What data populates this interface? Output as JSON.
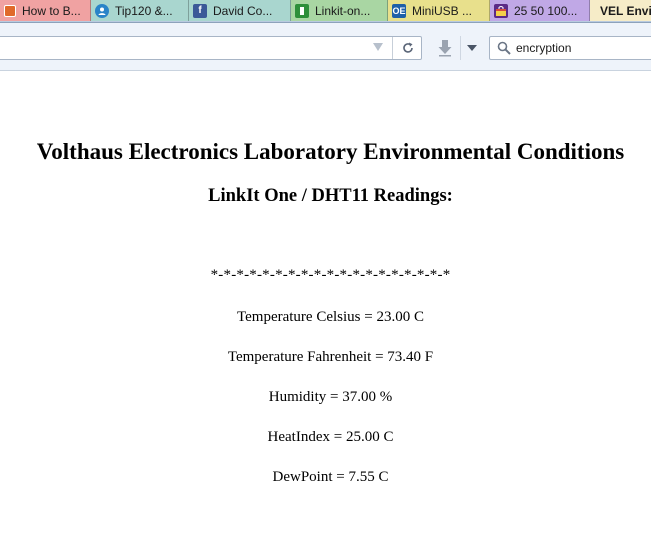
{
  "tabs": [
    {
      "label": "How to B...",
      "icon": "page-icon"
    },
    {
      "label": "Tip120 &...",
      "icon": "profile-icon"
    },
    {
      "label": "David Co...",
      "icon": "facebook-icon"
    },
    {
      "label": "Linkit-on...",
      "icon": "linkit-icon"
    },
    {
      "label": "MiniUSB ...",
      "icon": "oe-icon"
    },
    {
      "label": "25 50 100...",
      "icon": "shopping-bag-icon"
    },
    {
      "label": "VEL Envir",
      "icon": ""
    }
  ],
  "tab_icon_text": {
    "oe": "OE",
    "fb": "f"
  },
  "search": {
    "value": "encryption"
  },
  "page": {
    "title": "Volthaus Electronics Laboratory Environmental Conditions",
    "subtitle": "LinkIt One / DHT11 Readings:",
    "separator": "*-*-*-*-*-*-*-*-*-*-*-*-*-*-*-*-*-*-*",
    "readings": {
      "temp_c": "Temperature Celsius = 23.00 C",
      "temp_f": "Temperature Fahrenheit = 73.40 F",
      "humidity": "Humidity = 37.00 %",
      "heat_index": "HeatIndex = 25.00 C",
      "dew_point": "DewPoint = 7.55 C"
    }
  },
  "colors": {
    "tab_strip": "#b9cbe0",
    "active_tab": "#f6ecc8",
    "nav_bar": "#eef3fa"
  }
}
